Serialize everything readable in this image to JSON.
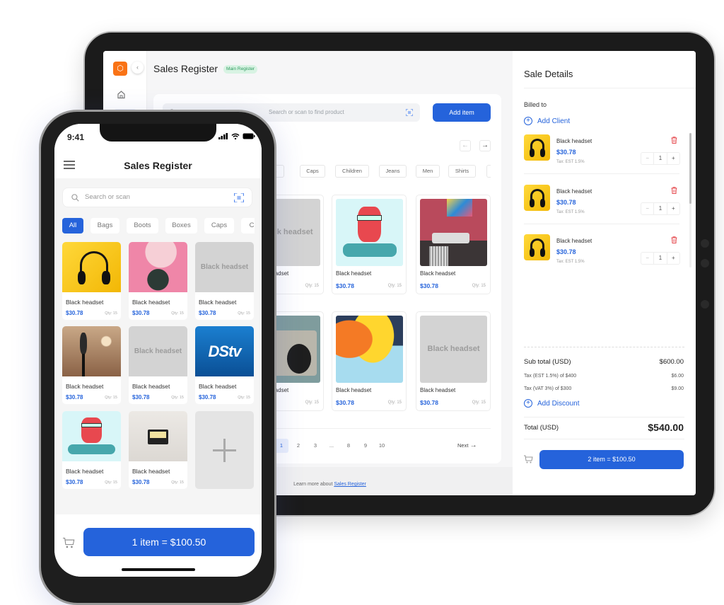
{
  "colors": {
    "accent": "#2563db",
    "logo": "#f97316",
    "danger": "#e5484d",
    "badge_bg": "#d8f3e3",
    "badge_text": "#2e9a5e"
  },
  "tablet": {
    "header": {
      "title": "Sales Register",
      "badge": "Main Register"
    },
    "sidebar": {
      "icons": [
        "logo-box-icon",
        "home-icon"
      ]
    },
    "search": {
      "placeholder": "Search or scan to find product"
    },
    "add_item_label": "Add item",
    "categories": [
      "Boxes",
      "Caps",
      "Children",
      "Jeans",
      "Men",
      "Shirts",
      ""
    ],
    "products": [
      {
        "name": "Black headset",
        "price": "$30.78",
        "qty": "Qty: 15",
        "image": "placeholder",
        "image_text": "Black headset"
      },
      {
        "name": "Black headset",
        "price": "$30.78",
        "qty": "Qty: 15",
        "image": "dj-monster"
      },
      {
        "name": "Black headset",
        "price": "$30.78",
        "qty": "Qty: 15",
        "image": "turntable"
      },
      {
        "name": "Black headset",
        "price": "$30.78",
        "qty": "Qty: 15",
        "image": "boombox"
      },
      {
        "name": "Black headset",
        "price": "$30.78",
        "qty": "Qty: 15",
        "image": "abstract"
      },
      {
        "name": "Black headset",
        "price": "$30.78",
        "qty": "Qty: 15",
        "image": "placeholder",
        "image_text": "Black headset"
      }
    ],
    "pagination": {
      "pages": [
        "1",
        "2",
        "3",
        "...",
        "8",
        "9",
        "10"
      ],
      "current": "1",
      "next_label": "Next"
    },
    "footer": {
      "text": "Learn more about ",
      "link": "Sales Register"
    },
    "sale_details": {
      "title": "Sale Details",
      "billed_to": "Billed to",
      "add_client": "Add Client",
      "items": [
        {
          "name": "Black headset",
          "price": "$30.78",
          "tax": "Tax: EST 1.5%",
          "qty": "1"
        },
        {
          "name": "Black headset",
          "price": "$30.78",
          "tax": "Tax: EST 1.5%",
          "qty": "1"
        },
        {
          "name": "Black headset",
          "price": "$30.78",
          "tax": "Tax: EST 1.5%",
          "qty": "1"
        }
      ],
      "subtotal_label": "Sub total (USD)",
      "subtotal": "$600.00",
      "taxes": [
        {
          "label": "Tax (EST 1.5%) of $400",
          "value": "$6.00"
        },
        {
          "label": "Tax (VAT 3%) of $300",
          "value": "$9.00"
        }
      ],
      "add_discount": "Add Discount",
      "total_label": "Total (USD)",
      "total": "$540.00",
      "checkout_label": "2 item = $100.50"
    }
  },
  "phone": {
    "time": "9:41",
    "title": "Sales Register",
    "search": {
      "placeholder": "Search or scan"
    },
    "categories": [
      "All",
      "Bags",
      "Boots",
      "Boxes",
      "Caps",
      "C"
    ],
    "active_category": "All",
    "products": [
      {
        "name": "Black headset",
        "price": "$30.78",
        "qty": "Qty: 15",
        "image": "headphones"
      },
      {
        "name": "Black headset",
        "price": "$30.78",
        "qty": "Qty: 15",
        "image": "pink-girl"
      },
      {
        "name": "Black headset",
        "price": "$30.78",
        "qty": "Qty: 15",
        "image": "placeholder",
        "image_text": "Black headset"
      },
      {
        "name": "Black headset",
        "price": "$30.78",
        "qty": "Qty: 15",
        "image": "microphone"
      },
      {
        "name": "Black headset",
        "price": "$30.78",
        "qty": "Qty: 15",
        "image": "placeholder",
        "image_text": "Black headset"
      },
      {
        "name": "Black headset",
        "price": "$30.78",
        "qty": "Qty: 15",
        "image": "dstv",
        "image_text": "DStv"
      },
      {
        "name": "Black headset",
        "price": "$30.78",
        "qty": "Qty: 15",
        "image": "dj-monster"
      },
      {
        "name": "Black headset",
        "price": "$30.78",
        "qty": "Qty: 15",
        "image": "cassette"
      }
    ],
    "checkout_label": "1 item = $100.50"
  }
}
